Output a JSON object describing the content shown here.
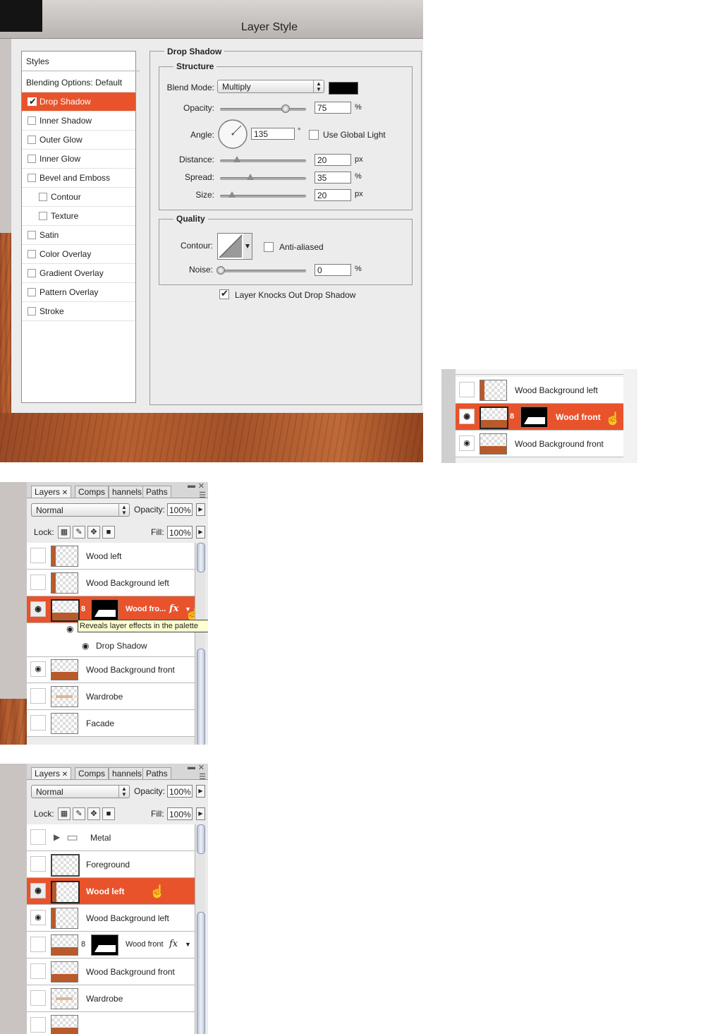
{
  "layer_style": {
    "title": "Layer Style",
    "styles_header": "Styles",
    "styles": [
      {
        "label": "Blending Options: Default",
        "checkbox": false,
        "checked": false,
        "selected": false,
        "indent": false
      },
      {
        "label": "Drop Shadow",
        "checkbox": true,
        "checked": true,
        "selected": true,
        "indent": false
      },
      {
        "label": "Inner Shadow",
        "checkbox": true,
        "checked": false,
        "selected": false,
        "indent": false
      },
      {
        "label": "Outer Glow",
        "checkbox": true,
        "checked": false,
        "selected": false,
        "indent": false
      },
      {
        "label": "Inner Glow",
        "checkbox": true,
        "checked": false,
        "selected": false,
        "indent": false
      },
      {
        "label": "Bevel and Emboss",
        "checkbox": true,
        "checked": false,
        "selected": false,
        "indent": false
      },
      {
        "label": "Contour",
        "checkbox": true,
        "checked": false,
        "selected": false,
        "indent": true
      },
      {
        "label": "Texture",
        "checkbox": true,
        "checked": false,
        "selected": false,
        "indent": true
      },
      {
        "label": "Satin",
        "checkbox": true,
        "checked": false,
        "selected": false,
        "indent": false
      },
      {
        "label": "Color Overlay",
        "checkbox": true,
        "checked": false,
        "selected": false,
        "indent": false
      },
      {
        "label": "Gradient Overlay",
        "checkbox": true,
        "checked": false,
        "selected": false,
        "indent": false
      },
      {
        "label": "Pattern Overlay",
        "checkbox": true,
        "checked": false,
        "selected": false,
        "indent": false
      },
      {
        "label": "Stroke",
        "checkbox": true,
        "checked": false,
        "selected": false,
        "indent": false
      }
    ],
    "section_title": "Drop Shadow",
    "structure": {
      "legend": "Structure",
      "blend_mode_label": "Blend Mode:",
      "blend_mode_value": "Multiply",
      "shadow_color": "#000000",
      "opacity_label": "Opacity:",
      "opacity_value": "75",
      "opacity_unit": "%",
      "opacity_level": 0.75,
      "angle_label": "Angle:",
      "angle_value": "135",
      "angle_unit": "°",
      "angle_degrees": 135,
      "use_global_light_label": "Use Global Light",
      "use_global_light_checked": false,
      "distance_label": "Distance:",
      "distance_value": "20",
      "distance_unit": "px",
      "distance_level": 0.2,
      "spread_label": "Spread:",
      "spread_value": "35",
      "spread_unit": "%",
      "spread_level": 0.35,
      "size_label": "Size:",
      "size_value": "20",
      "size_unit": "px",
      "size_level": 0.14
    },
    "quality": {
      "legend": "Quality",
      "contour_label": "Contour:",
      "anti_aliased_label": "Anti-aliased",
      "anti_aliased_checked": false,
      "noise_label": "Noise:",
      "noise_value": "0",
      "noise_unit": "%",
      "noise_level": 0
    },
    "knockout_label": "Layer Knocks Out Drop Shadow",
    "knockout_checked": true
  },
  "mini_layers": {
    "rows": [
      {
        "name": "Wood Background left",
        "visible": false,
        "selected": false,
        "mask": false
      },
      {
        "name": "Wood front",
        "visible": true,
        "selected": true,
        "mask": true
      },
      {
        "name": "Wood Background front",
        "visible": true,
        "selected": false,
        "mask": false
      }
    ]
  },
  "layers_panel_1": {
    "tabs": [
      "Layers",
      "Comps",
      "hannels",
      "Paths"
    ],
    "blend_mode": "Normal",
    "opacity_label": "Opacity:",
    "opacity_value": "100%",
    "lock_label": "Lock:",
    "fill_label": "Fill:",
    "fill_value": "100%",
    "rows": [
      {
        "name": "Wood left",
        "visible": false,
        "selected": false
      },
      {
        "name": "Wood Background left",
        "visible": false,
        "selected": false
      },
      {
        "name": "Wood fro...",
        "visible": true,
        "selected": true,
        "mask": true,
        "fx": "fx"
      },
      {
        "name": "Wood Background front",
        "visible": true,
        "selected": false
      },
      {
        "name": "Wardrobe",
        "visible": false,
        "selected": false
      },
      {
        "name": "Facade",
        "visible": false,
        "selected": false
      }
    ],
    "tooltip": "Reveals layer effects in the palette",
    "effect_row": "Drop Shadow"
  },
  "layers_panel_2": {
    "tabs": [
      "Layers",
      "Comps",
      "hannels",
      "Paths"
    ],
    "blend_mode": "Normal",
    "opacity_label": "Opacity:",
    "opacity_value": "100%",
    "lock_label": "Lock:",
    "fill_label": "Fill:",
    "fill_value": "100%",
    "rows": [
      {
        "name": "Metal",
        "visible": false,
        "selected": false,
        "group": true
      },
      {
        "name": "Foreground",
        "visible": false,
        "selected": false
      },
      {
        "name": "Wood left",
        "visible": true,
        "selected": true
      },
      {
        "name": "Wood Background left",
        "visible": true,
        "selected": false
      },
      {
        "name": "Wood front",
        "visible": false,
        "selected": false,
        "mask": true,
        "fx": "fx"
      },
      {
        "name": "Wood Background front",
        "visible": false,
        "selected": false
      },
      {
        "name": "Wardrobe",
        "visible": false,
        "selected": false
      },
      {
        "name": "",
        "visible": false,
        "selected": false
      }
    ]
  },
  "colors": {
    "selection": "#e8532c",
    "dialog_bg": "#ececec"
  }
}
